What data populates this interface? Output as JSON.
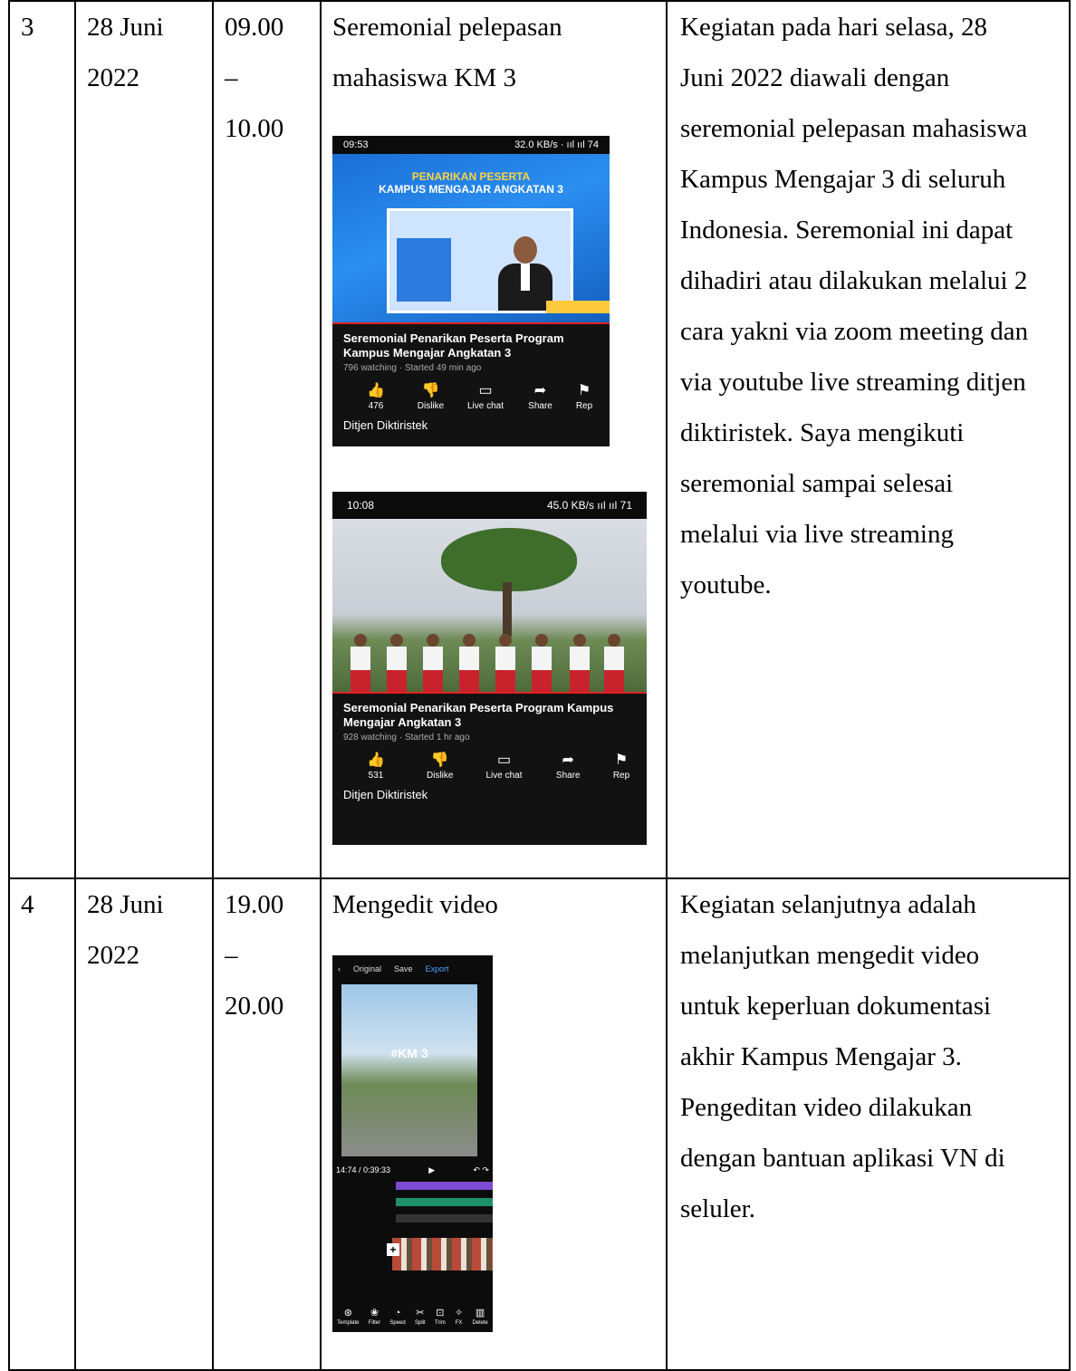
{
  "rows": [
    {
      "no": "3",
      "date": [
        "28 Juni",
        "2022"
      ],
      "time": [
        "09.00",
        "–",
        "10.00"
      ],
      "activity": [
        "Seremonial pelepasan",
        "mahasiswa KM 3"
      ],
      "description": [
        "Kegiatan pada hari selasa, 28",
        "Juni 2022 diawali dengan",
        "seremonial pelepasan mahasiswa",
        "Kampus Mengajar 3 di seluruh",
        "Indonesia. Seremonial ini dapat",
        "dihadiri atau dilakukan melalui 2",
        "cara yakni via zoom meeting dan",
        "via youtube live streaming ditjen",
        "diktiristek. Saya mengikuti",
        "seremonial sampai selesai",
        "melalui via live streaming",
        "youtube."
      ],
      "screenshot1": {
        "time": "09:53",
        "status_icons": "32.0 KB/s · ııl ııl 74",
        "banner_line1": "PENARIKAN PESERTA",
        "banner_line2": "KAMPUS MENGAJAR ANGKATAN 3",
        "video_title": "Seremonial Penarikan Peserta Program Kampus Mengajar Angkatan 3",
        "meta": "796 watching · Started 49 min ago",
        "like_count": "476",
        "dislike": "Dislike",
        "live_chat": "Live chat",
        "share": "Share",
        "report": "Rep",
        "channel": "Ditjen Diktiristek"
      },
      "screenshot2": {
        "time": "10:08",
        "status_icons": "45.0 KB/s ııl ııl 71",
        "video_title": "Seremonial Penarikan Peserta Program Kampus Mengajar Angkatan 3",
        "meta": "928 watching · Started 1 hr ago",
        "like_count": "531",
        "dislike": "Dislike",
        "live_chat": "Live chat",
        "share": "Share",
        "report": "Rep",
        "channel": "Ditjen Diktiristek"
      }
    },
    {
      "no": "4",
      "date": [
        "28 Juni",
        "2022"
      ],
      "time": [
        "19.00",
        "–",
        "20.00"
      ],
      "activity": [
        "Mengedit video"
      ],
      "description": [
        "Kegiatan selanjutnya adalah",
        "melanjutkan mengedit video",
        "untuk keperluan dokumentasi",
        "akhir Kampus Mengajar 3.",
        "Pengeditan video dilakukan",
        "dengan bantuan aplikasi VN di",
        "seluler."
      ],
      "screenshot3": {
        "ratio": "Original",
        "save": "Save",
        "export": "Export",
        "overlay_text": "#KM 3",
        "timecode": "14:74 / 0:39:33",
        "tools": [
          "Template",
          "Filter",
          "Speed",
          "Split",
          "Trim",
          "FX",
          "Delete"
        ]
      }
    }
  ],
  "colors": {
    "youtube_red": "#e02020",
    "banner_blue": "#1a6fd6",
    "banner_yellow": "#ffd23f"
  }
}
